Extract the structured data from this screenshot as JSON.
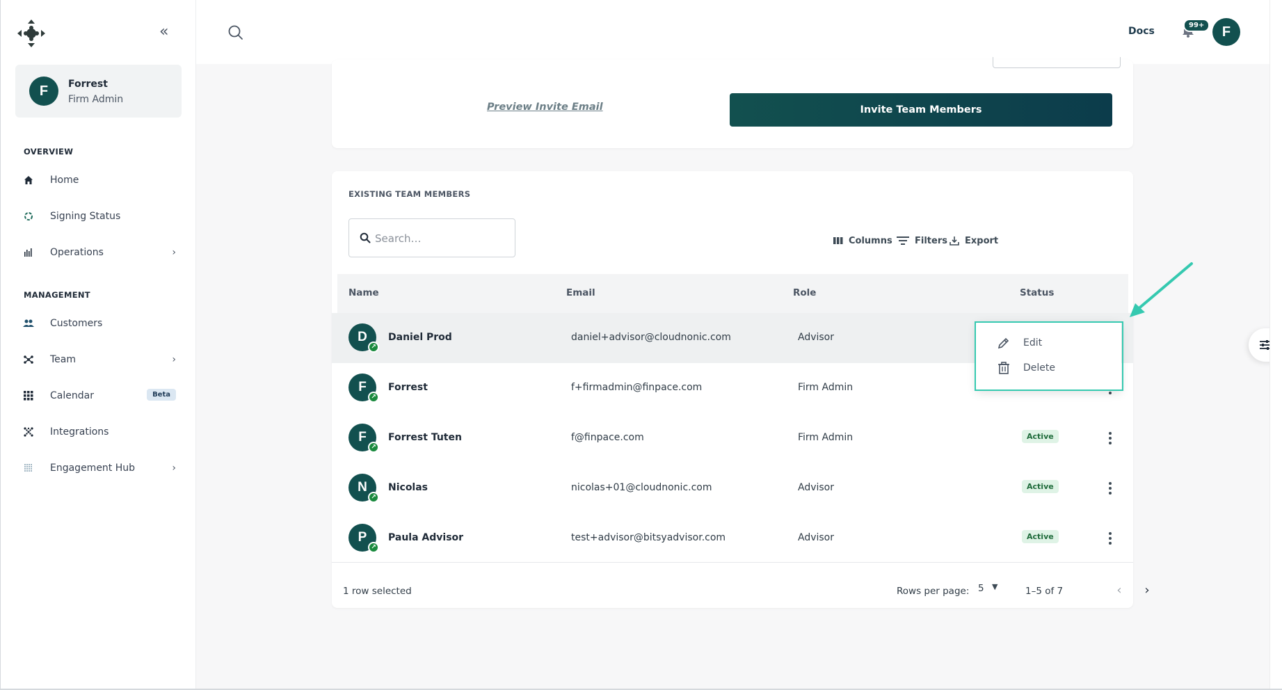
{
  "sidebar": {
    "user": {
      "initial": "F",
      "name": "Forrest",
      "role": "Firm Admin"
    },
    "sections": {
      "overview": "OVERVIEW",
      "management": "MANAGEMENT"
    },
    "items": [
      {
        "label": "Home",
        "icon": "home-icon"
      },
      {
        "label": "Signing Status",
        "icon": "signing-status-icon"
      },
      {
        "label": "Operations",
        "icon": "operations-icon"
      },
      {
        "label": "Customers",
        "icon": "customers-icon"
      },
      {
        "label": "Team",
        "icon": "team-icon"
      },
      {
        "label": "Calendar",
        "icon": "calendar-icon",
        "badge": "Beta"
      },
      {
        "label": "Integrations",
        "icon": "integrations-icon"
      },
      {
        "label": "Engagement Hub",
        "icon": "engagement-hub-icon"
      }
    ]
  },
  "header": {
    "docs": "Docs",
    "notifications": "99+",
    "avatar_initial": "F"
  },
  "invite": {
    "preview_link": "Preview Invite Email",
    "invite_button": "Invite Team Members"
  },
  "team": {
    "title": "EXISTING TEAM MEMBERS",
    "search_placeholder": "Search…",
    "toolbar": {
      "columns": "Columns",
      "filters": "Filters",
      "export": "Export"
    },
    "columns": {
      "name": "Name",
      "email": "Email",
      "role": "Role",
      "status": "Status"
    },
    "rows": [
      {
        "initial": "D",
        "name": "Daniel Prod",
        "email": "daniel+advisor@cloudnonic.com",
        "role": "Advisor",
        "status": ""
      },
      {
        "initial": "F",
        "name": "Forrest",
        "email": "f+firmadmin@finpace.com",
        "role": "Firm Admin",
        "status": ""
      },
      {
        "initial": "F",
        "name": "Forrest Tuten",
        "email": "f@finpace.com",
        "role": "Firm Admin",
        "status": "Active"
      },
      {
        "initial": "N",
        "name": "Nicolas",
        "email": "nicolas+01@cloudnonic.com",
        "role": "Advisor",
        "status": "Active"
      },
      {
        "initial": "P",
        "name": "Paula Advisor",
        "email": "test+advisor@bitsyadvisor.com",
        "role": "Advisor",
        "status": "Active"
      }
    ],
    "footer": {
      "selected": "1 row selected",
      "rows_per_page_label": "Rows per page:",
      "rows_per_page": "5",
      "range": "1–5 of 7"
    }
  },
  "context_menu": {
    "edit": "Edit",
    "delete": "Delete"
  },
  "colors": {
    "brand": "#12504f",
    "active_badge_bg": "#dff3e6",
    "highlight": "#35c9b0"
  }
}
